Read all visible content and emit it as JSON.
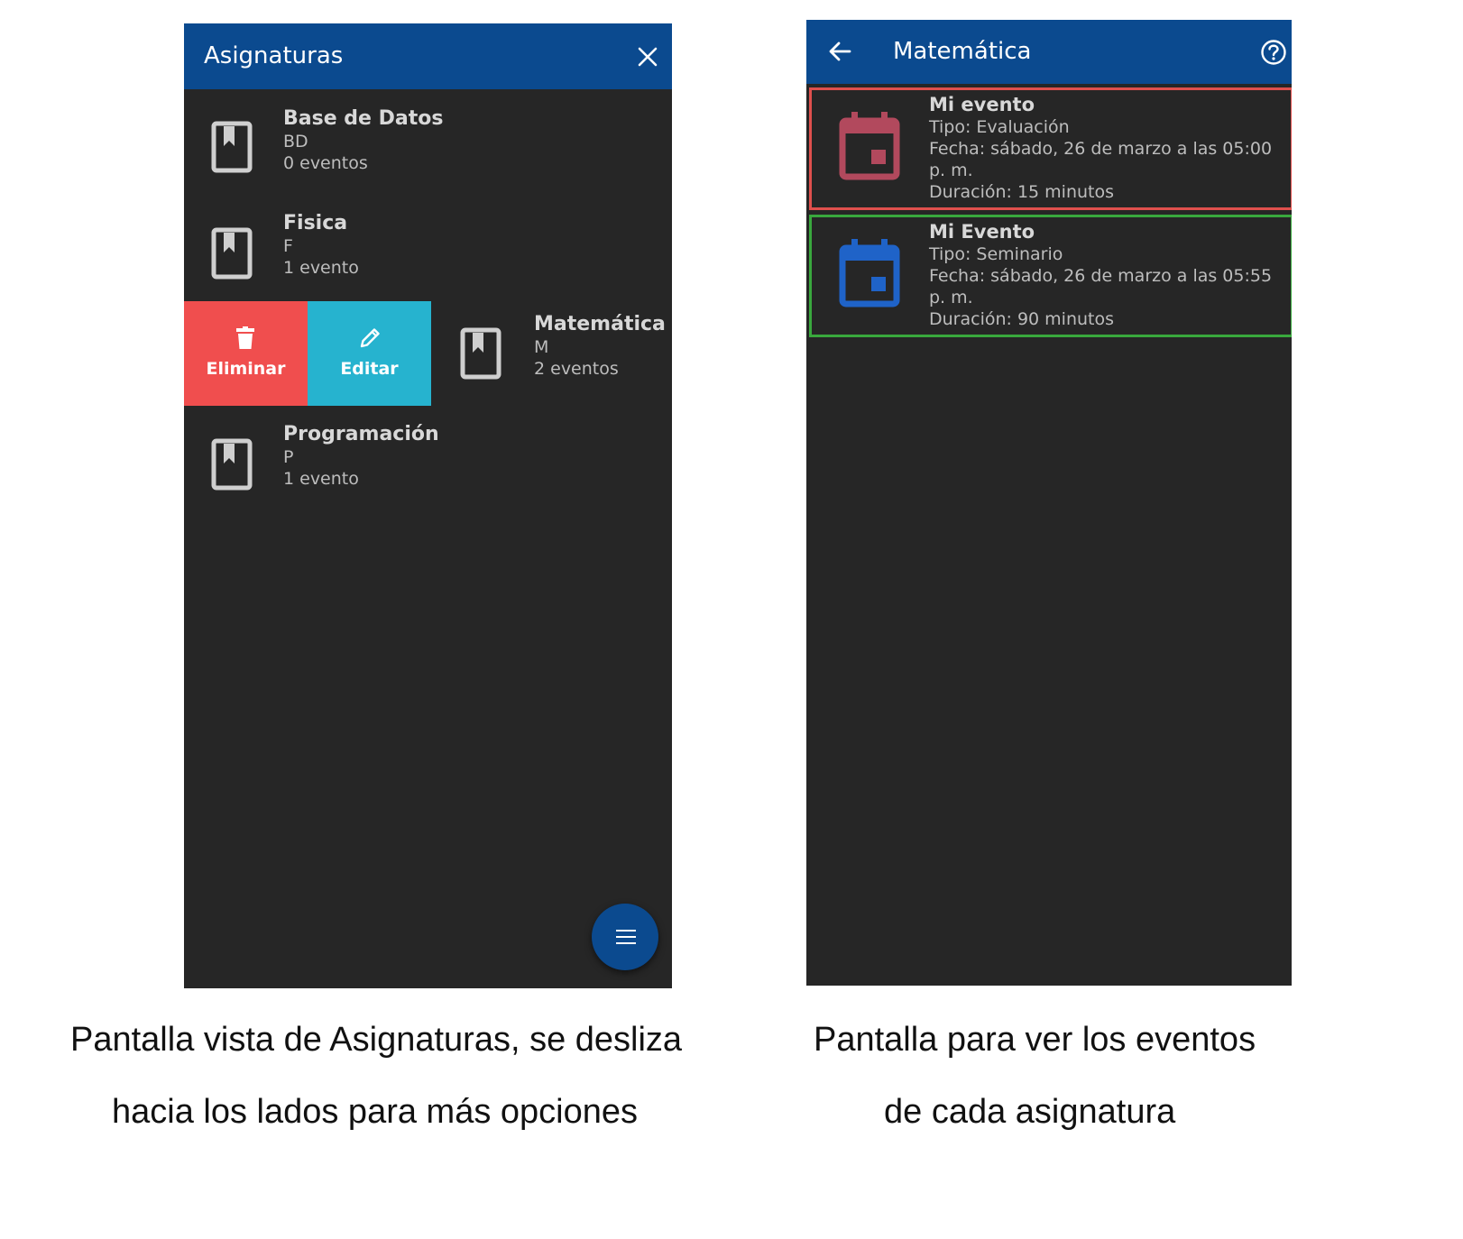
{
  "left_screen": {
    "appbar": {
      "title": "Asignaturas",
      "close_icon": "close-icon"
    },
    "subjects": [
      {
        "name": "Base de Datos",
        "code": "BD",
        "events": "0 eventos"
      },
      {
        "name": "Fisica",
        "code": "F",
        "events": "1 evento"
      },
      {
        "name": "Matemática",
        "code": "M",
        "events": "2 eventos"
      },
      {
        "name": "Programación",
        "code": "P",
        "events": "1 evento"
      }
    ],
    "swipe_actions": {
      "delete": {
        "label": "Eliminar",
        "color": "#f04e4e",
        "icon": "trash-icon"
      },
      "edit": {
        "label": "Editar",
        "color": "#26b3cf",
        "icon": "pencil-icon"
      }
    },
    "fab_icon": "menu-icon"
  },
  "right_screen": {
    "appbar": {
      "title": "Matemática",
      "back_icon": "arrow-back-icon",
      "help_icon": "help-icon"
    },
    "events": [
      {
        "title": "Mi evento",
        "tipo": "Tipo: Evaluación",
        "fecha_1": "Fecha: sábado, 26 de marzo a las 05:00",
        "fecha_2": "p. m.",
        "duracion": "Duración: 15 minutos",
        "color": "#e0504d",
        "icon_color": "#b2495d"
      },
      {
        "title": "Mi Evento",
        "tipo": "Tipo: Seminario",
        "fecha_1": "Fecha: sábado, 26 de marzo a las 05:55",
        "fecha_2": "p. m.",
        "duracion": "Duración: 90 minutos",
        "color": "#39a83d",
        "icon_color": "#1f63c8"
      }
    ]
  },
  "captions": {
    "left_line1": "Pantalla vista de Asignaturas, se desliza",
    "left_line2": "hacia los lados para más opciones",
    "right_line1": "Pantalla para ver los eventos",
    "right_line2": "de cada asignatura"
  },
  "colors": {
    "appbar": "#0b4a8f",
    "background": "#262626"
  }
}
